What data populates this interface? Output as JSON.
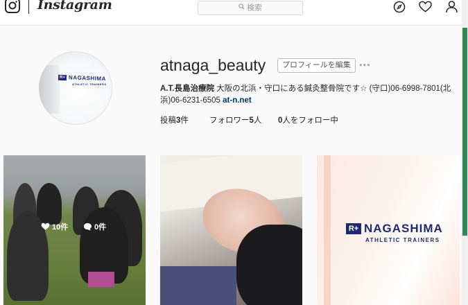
{
  "header": {
    "wordmark": "Instagram",
    "search_placeholder": "検索",
    "icons": [
      "instagram-logo-icon",
      "search-icon",
      "compass-icon",
      "heart-icon",
      "profile-icon"
    ]
  },
  "profile": {
    "username": "atnaga_beauty",
    "edit_button": "プロフィールを編集",
    "more": "•••",
    "avatar": {
      "brand": "NAGASHIMA",
      "sub": "ATHLETIC TRAINERS",
      "plus": "R+"
    },
    "bio": {
      "name": "A.T.長島治療院",
      "text": " 大阪の北浜・守口にある鍼灸整骨院です☆ (守口)06-6998-7801(北浜)06-6231-6505 ",
      "link": "at-n.net"
    },
    "stats": {
      "posts_label": "投稿",
      "posts_count": "3",
      "posts_suffix": "件",
      "followers_label": "フォロワー",
      "followers_count": "5",
      "followers_suffix": "人",
      "following_count": "0",
      "following_label": "人をフォロー中"
    }
  },
  "posts": [
    {
      "likes": "10件",
      "comments": "0件"
    },
    {},
    {
      "brand": "NAGASHIMA",
      "sub": "ATHLETIC TRAINERS",
      "plus": "R+"
    }
  ],
  "colors": {
    "accent": "#1d2a72",
    "link": "#003569",
    "background": "#fafafa"
  }
}
